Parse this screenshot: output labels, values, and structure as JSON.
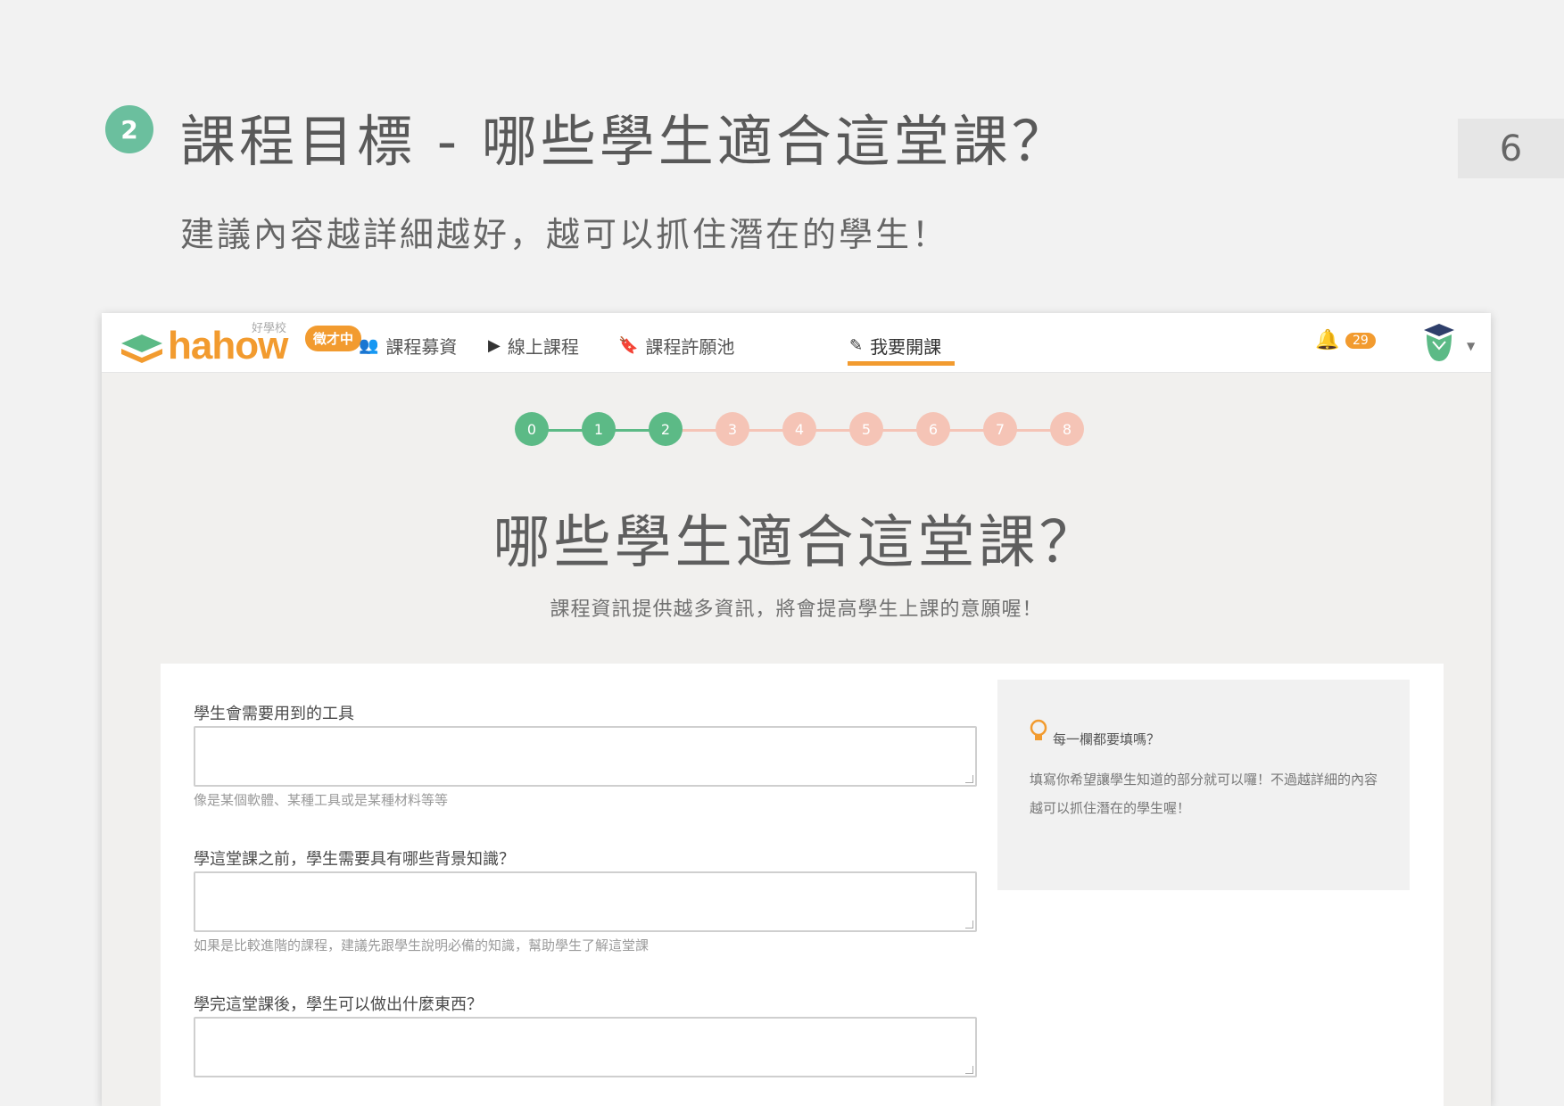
{
  "slide": {
    "step_number": "2",
    "title": "課程目標 - 哪些學生適合這堂課？",
    "subtitle": "建議內容越詳細越好，越可以抓住潛在的學生！",
    "page_number": "6"
  },
  "navbar": {
    "logo_text": "hahow",
    "logo_tagline": "好學校",
    "logo_badge": "徵才中",
    "items": [
      {
        "label": "課程募資",
        "icon": "users-icon"
      },
      {
        "label": "線上課程",
        "icon": "play-circle-icon"
      },
      {
        "label": "課程許願池",
        "icon": "bookmark-icon"
      },
      {
        "label": "我要開課",
        "icon": "pencil-icon"
      }
    ],
    "notification_count": "29"
  },
  "stepper": {
    "steps": [
      "0",
      "1",
      "2",
      "3",
      "4",
      "5",
      "6",
      "7",
      "8"
    ],
    "completed_color": "#5cba86",
    "pending_color": "#f5c4b6",
    "current_index": 2
  },
  "form": {
    "heading": "哪些學生適合這堂課？",
    "subheading": "課程資訊提供越多資訊，將會提高學生上課的意願喔！",
    "fields": [
      {
        "label": "學生會需要用到的工具",
        "hint": "像是某個軟體、某種工具或是某種材料等等"
      },
      {
        "label": "學這堂課之前，學生需要具有哪些背景知識？",
        "hint": "如果是比較進階的課程，建議先跟學生說明必備的知識，幫助學生了解這堂課"
      },
      {
        "label": "學完這堂課後，學生可以做出什麼東西？",
        "hint": ""
      }
    ],
    "tip": {
      "title": "每一欄都要填嗎？",
      "body": "填寫你希望讓學生知道的部分就可以囉！不過越詳細的內容越可以抓住潛在的學生喔！"
    }
  },
  "colors": {
    "accent": "#f29b2f",
    "step_badge": "#6bbf9e"
  }
}
